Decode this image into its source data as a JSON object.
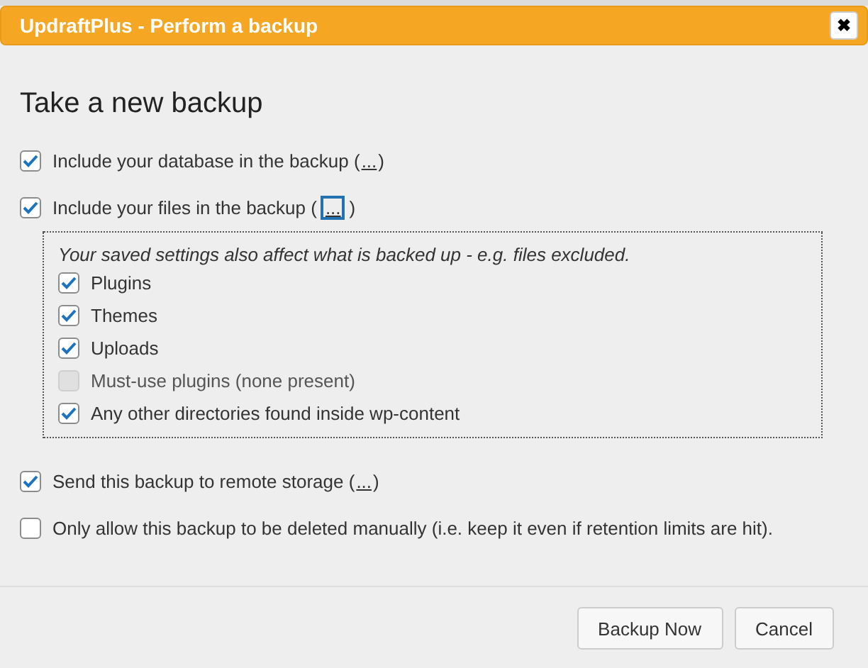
{
  "window": {
    "title": "UpdraftPlus - Perform a backup",
    "close": "✖"
  },
  "heading": "Take a new backup",
  "options": [
    {
      "before": "Include your database in the backup (",
      "link": "...",
      "after": ")",
      "checked": true,
      "focused": false
    },
    {
      "before": "Include your files in the backup (",
      "link": "...",
      "after": ")",
      "checked": true,
      "focused": true
    }
  ],
  "files_panel": {
    "note": "Your saved settings also affect what is backed up - e.g. files excluded.",
    "items": [
      {
        "label": "Plugins",
        "checked": true,
        "disabled": false
      },
      {
        "label": "Themes",
        "checked": true,
        "disabled": false
      },
      {
        "label": "Uploads",
        "checked": true,
        "disabled": false
      },
      {
        "label": "Must-use plugins (none present)",
        "checked": false,
        "disabled": true
      },
      {
        "label": "Any other directories found inside wp-content",
        "checked": true,
        "disabled": false
      }
    ]
  },
  "extra_options": [
    {
      "before": "Send this backup to remote storage (",
      "link": "...",
      "after": ")",
      "checked": true,
      "focused": false
    },
    {
      "before": "Only allow this backup to be deleted manually (i.e. keep it even if retention limits are hit).",
      "checked": false
    }
  ],
  "buttons": [
    "Backup Now",
    "Cancel"
  ]
}
